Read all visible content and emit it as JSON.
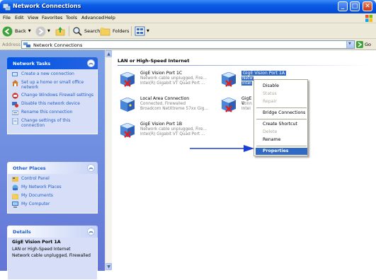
{
  "window": {
    "title": "Network Connections",
    "controls": [
      "minimize",
      "maximize",
      "close"
    ]
  },
  "menubar": {
    "items": [
      "File",
      "Edit",
      "View",
      "Favorites",
      "Tools",
      "Advanced",
      "Help"
    ]
  },
  "toolbar": {
    "back_label": "Back",
    "search_label": "Search",
    "folders_label": "Folders"
  },
  "address": {
    "label": "Address",
    "value": "Network Connections",
    "go_label": "Go"
  },
  "tasks": {
    "network_tasks": {
      "title": "Network Tasks",
      "items": [
        "Create a new connection",
        "Set up a home or small office network",
        "Change Windows Firewall settings",
        "Disable this network device",
        "Rename this connection",
        "Change settings of this connection"
      ]
    },
    "other_places": {
      "title": "Other Places",
      "items": [
        "Control Panel",
        "My Network Places",
        "My Documents",
        "My Computer"
      ]
    },
    "details": {
      "title": "Details",
      "name": "GigE Vision Port 1A",
      "type": "LAN or High-Speed Internet",
      "status": "Network cable unplugged, Firewalled"
    }
  },
  "main": {
    "group_title": "LAN or High-Speed Internet",
    "connections": [
      {
        "name": "GigE Vision Port 1C",
        "line1": "Network cable unplugged, Fire...",
        "line2": "Intel(R) Gigabit VT Quad Port ..."
      },
      {
        "name": "GigE Vision Port 1A",
        "line1": "Netw",
        "line2": "Intel"
      },
      {
        "name": "Local Area Connection",
        "line1": "Connected, Firewalled",
        "line2": "Broadcom NetXtreme 57xx Gig..."
      },
      {
        "name": "GigE V",
        "line1": "Conn",
        "line2": "Intel"
      },
      {
        "name": "GigE Vision Port 1B",
        "line1": "Network cable unplugged, Fire...",
        "line2": "Intel(R) Gigabit VT Quad Port ..."
      }
    ]
  },
  "context_menu": {
    "items": [
      {
        "label": "Disable",
        "enabled": true
      },
      {
        "label": "Status",
        "enabled": false
      },
      {
        "label": "Repair",
        "enabled": false
      },
      {
        "label": "Bridge Connections",
        "enabled": true
      },
      {
        "label": "Create Shortcut",
        "enabled": true
      },
      {
        "label": "Delete",
        "enabled": false
      },
      {
        "label": "Rename",
        "enabled": true
      },
      {
        "label": "Properties",
        "enabled": true,
        "highlighted": true
      }
    ]
  },
  "colors": {
    "titlebar": "#0a5ae6",
    "task_pane": "#7ba2e7",
    "link_blue": "#215dc6",
    "selection": "#316ac5",
    "annotation_arrow": "#1a3fd6"
  }
}
